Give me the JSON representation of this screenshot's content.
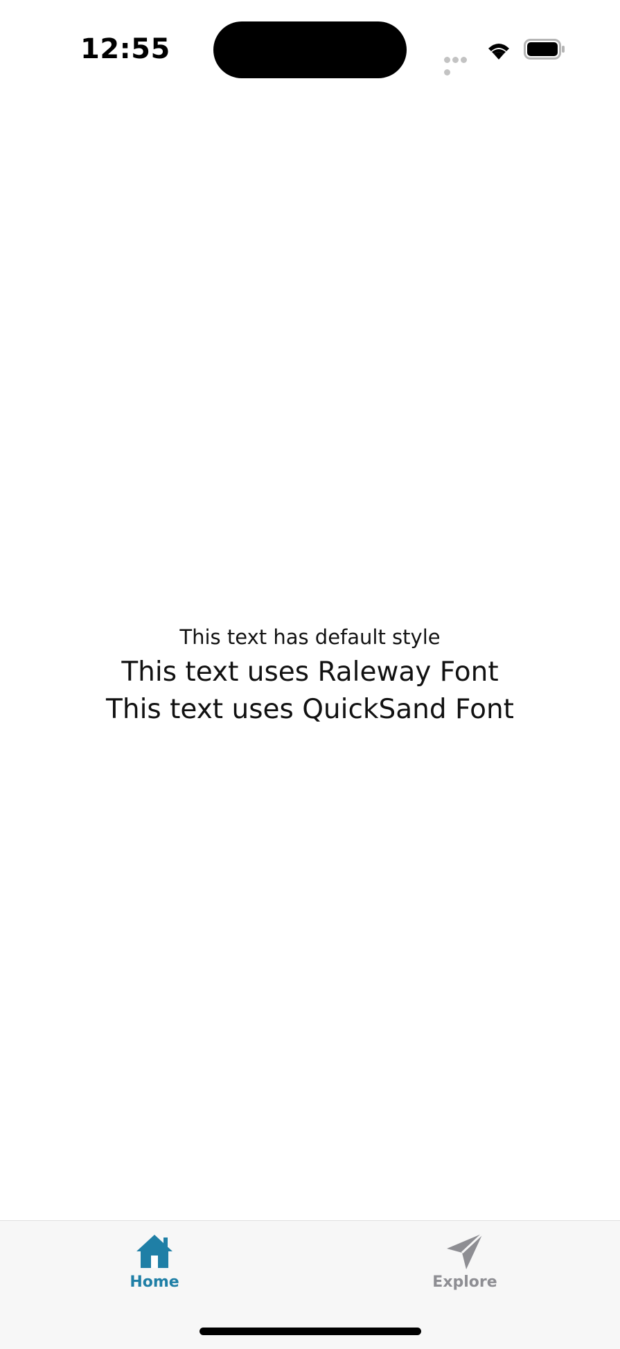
{
  "status_bar": {
    "time": "12:55"
  },
  "content": {
    "line_default": "This text has default style",
    "line_raleway": "This text uses Raleway Font",
    "line_quicksand": "This text uses QuickSand Font"
  },
  "tabs": [
    {
      "label": "Home",
      "icon": "home-icon",
      "active": true
    },
    {
      "label": "Explore",
      "icon": "paper-plane-icon",
      "active": false
    }
  ],
  "colors": {
    "active_tab": "#1f7fa6",
    "inactive_tab": "#8e8e93",
    "tab_bar_bg": "#f7f7f7"
  }
}
